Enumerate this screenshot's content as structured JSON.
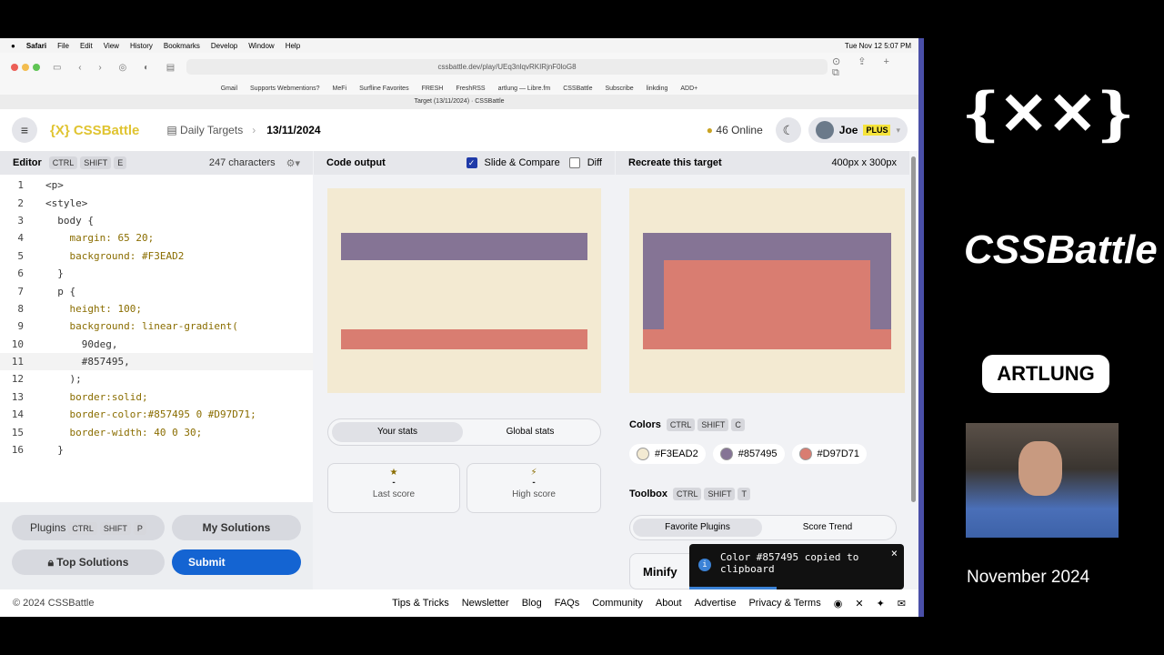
{
  "menubar": {
    "items": [
      "Safari",
      "File",
      "Edit",
      "View",
      "History",
      "Bookmarks",
      "Develop",
      "Window",
      "Help"
    ],
    "clock": "Tue Nov 12  5:07 PM"
  },
  "browser": {
    "url": "cssbattle.dev/play/UEq3nlqvRKIRjnF0loG8",
    "bookmarks": [
      "Gmail",
      "Supports Webmentions?",
      "MeFi",
      "Surfline Favorites",
      "FRESH",
      "FreshRSS",
      "artlung — Libre.fm",
      "CSSBattle",
      "Subscribe",
      "linkding",
      "ADD+"
    ],
    "tab": "Target (13/11/2024) · CSSBattle"
  },
  "header": {
    "logo": "{X} CSSBattle",
    "crumb": "Daily Targets",
    "date": "13/11/2024",
    "online": "46 Online",
    "user": "Joe",
    "badge": "PLUS"
  },
  "editor": {
    "title": "Editor",
    "keys": [
      "CTRL",
      "SHIFT",
      "E"
    ],
    "chars": "247 characters",
    "lines": [
      "<p>",
      "<style>",
      "  body {",
      "    margin: 65 20;",
      "    background: #F3EAD2",
      "  }",
      "  p {",
      "    height: 100;",
      "    background: linear-gradient(",
      "      90deg,",
      "      #857495,",
      "    );",
      "    border:solid;",
      "    border-color:#857495 0 #D97D71;",
      "    border-width: 40 0 30;",
      "  }"
    ]
  },
  "buttons": {
    "plugins": "Plugins",
    "plugins_keys": [
      "CTRL",
      "SHIFT",
      "P"
    ],
    "my_solutions": "My Solutions",
    "top_solutions": "Top Solutions",
    "submit": "Submit"
  },
  "output": {
    "title": "Code output",
    "slide": "Slide & Compare",
    "diff": "Diff",
    "tabs": [
      "Your stats",
      "Global stats"
    ],
    "last_score_label": "Last score",
    "last_score": "-",
    "high_score_label": "High score",
    "high_score": "-"
  },
  "target": {
    "title": "Recreate this target",
    "size": "400px x 300px",
    "colors_label": "Colors",
    "colors_keys": [
      "CTRL",
      "SHIFT",
      "C"
    ],
    "colors": [
      "#F3EAD2",
      "#857495",
      "#D97D71"
    ],
    "toolbox_label": "Toolbox",
    "toolbox_keys": [
      "CTRL",
      "SHIFT",
      "T"
    ],
    "toolbox_tabs": [
      "Favorite Plugins",
      "Score Trend"
    ],
    "minify": "Minify"
  },
  "toast": "Color #857495 copied to clipboard",
  "footer": {
    "copyright": "© 2024 CSSBattle",
    "links": [
      "Tips & Tricks",
      "Newsletter",
      "Blog",
      "FAQs",
      "Community",
      "About",
      "Advertise",
      "Privacy & Terms"
    ]
  },
  "side": {
    "logo": "{XX}",
    "brand": "CSSBattle",
    "artlung": "ARTLUNG",
    "month": "November 2024"
  }
}
